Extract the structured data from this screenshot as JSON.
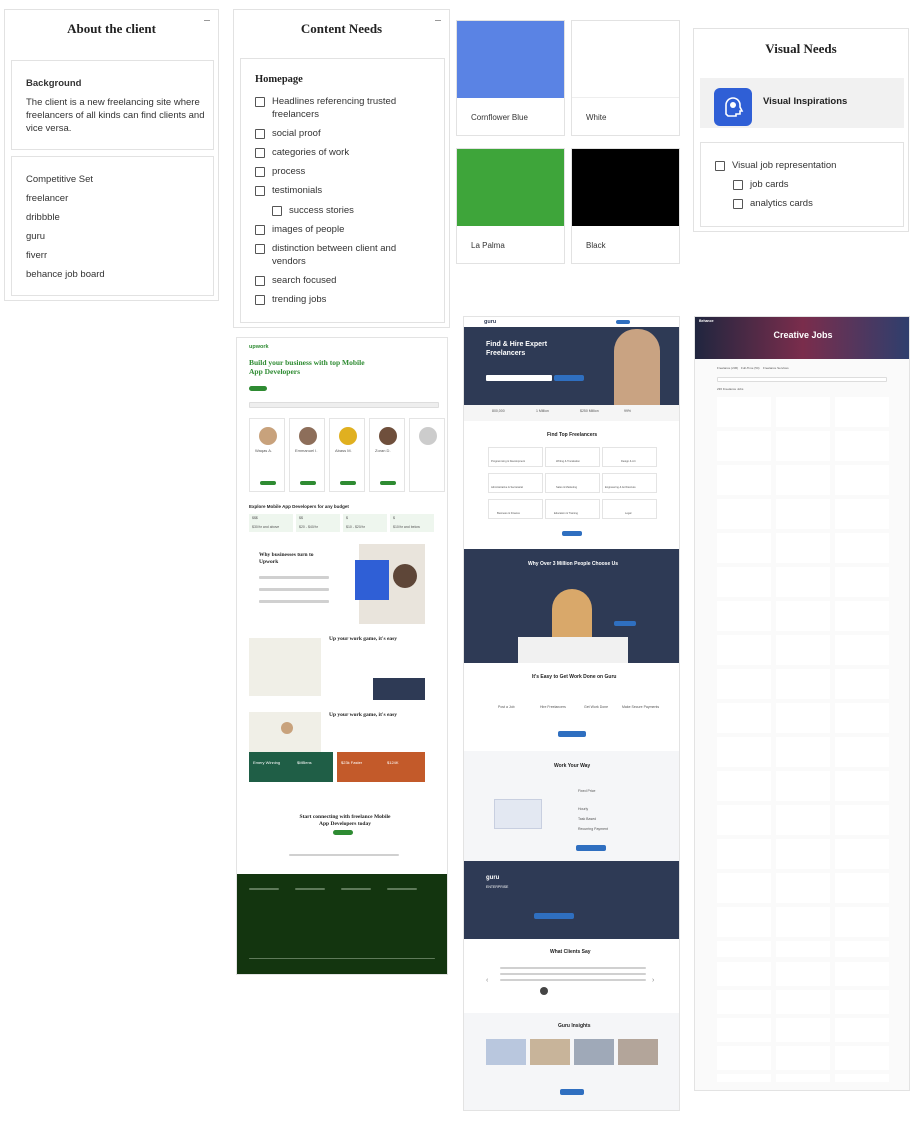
{
  "client": {
    "title": "About the client",
    "background_heading": "Background",
    "background_text": "The client is a new freelancing site where freelancers of all kinds can find clients and vice versa.",
    "competitive_heading": "Competitive Set",
    "competitors": [
      "freelancer",
      "dribbble",
      "guru",
      "fiverr",
      "behance job board"
    ]
  },
  "content": {
    "title": "Content Needs",
    "section": "Homepage",
    "items": [
      {
        "label": "Headlines referencing trusted freelancers",
        "indent": false
      },
      {
        "label": "social proof",
        "indent": false
      },
      {
        "label": "categories of work",
        "indent": false
      },
      {
        "label": "process",
        "indent": false
      },
      {
        "label": "testimonials",
        "indent": false
      },
      {
        "label": "success stories",
        "indent": true
      },
      {
        "label": "images of people",
        "indent": false
      },
      {
        "label": "distinction between client and vendors",
        "indent": false
      },
      {
        "label": "search focused",
        "indent": false
      },
      {
        "label": "trending jobs",
        "indent": false
      }
    ]
  },
  "palette": [
    {
      "name": "Cornflower Blue",
      "hex": "#5a83e4"
    },
    {
      "name": "White",
      "hex": "#ffffff"
    },
    {
      "name": "La Palma",
      "hex": "#3ea53a"
    },
    {
      "name": "Black",
      "hex": "#000000"
    }
  ],
  "visual": {
    "title": "Visual Needs",
    "inspirations_label": "Visual Inspirations",
    "inspirations_icon": "brain-head-icon",
    "items": [
      {
        "label": "Visual job representation",
        "indent": false
      },
      {
        "label": "job cards",
        "indent": true
      },
      {
        "label": "analytics cards",
        "indent": true
      }
    ]
  },
  "screens": {
    "upwork": {
      "brand": "upwork",
      "headline": "Build your business with top Mobile App Developers",
      "budget_heading": "Explore Mobile App Developers for any budget",
      "why_heading": "Why businesses turn to Upwork",
      "game_heading": "Up your work game, it's easy",
      "stat_left": "Emery Winning",
      "stat_mid": "$MBens",
      "stat_right": "$23k Faster",
      "stat_right2": "$124K",
      "cta_heading": "Start connecting with freelance Mobile App Developers today",
      "freelancer_names": [
        "Waqas A.",
        "Emmanuel I.",
        "Abass M.",
        "Zoran D."
      ],
      "budgets": [
        "$$$",
        "$$",
        "$",
        "$"
      ],
      "budget_ranges": [
        "$30/hr and above",
        "$20 - $40/hr",
        "$10 - $20/hr",
        "$10/hr and below"
      ]
    },
    "guru": {
      "brand": "guru",
      "hero": "Find & Hire Expert Freelancers",
      "top_heading": "Find Top Freelancers",
      "why_heading": "Why Over 3 Million People Choose Us",
      "easy_heading": "It's Easy to Get Work Done on Guru",
      "way_heading": "Work Your Way",
      "enterprise": "ENTERPRISE",
      "clients_heading": "What Clients Say",
      "insights_heading": "Guru Insights",
      "stats": [
        "800,000",
        "1 Million",
        "$250 Million",
        "99%"
      ],
      "categories": [
        "Programming & Development",
        "Writing & Translation",
        "Design & Art",
        "Administrative & Secretarial",
        "Sales & Marketing",
        "Engineering & Architecture",
        "Business & Finance",
        "Education & Training",
        "Legal"
      ],
      "steps": [
        "Post a Job",
        "Hire Freelancers",
        "Get Work Done",
        "Make Secure Payments"
      ],
      "payments": [
        "Fixed Price",
        "Hourly",
        "Task Based",
        "Recurring Payment"
      ]
    },
    "behance": {
      "brand": "Behance",
      "hero": "Creative Jobs",
      "tabs": [
        "Freelance (236)",
        "Full-Time (54)",
        "Freelance Services"
      ],
      "count": "236 Freelance Jobs"
    }
  }
}
